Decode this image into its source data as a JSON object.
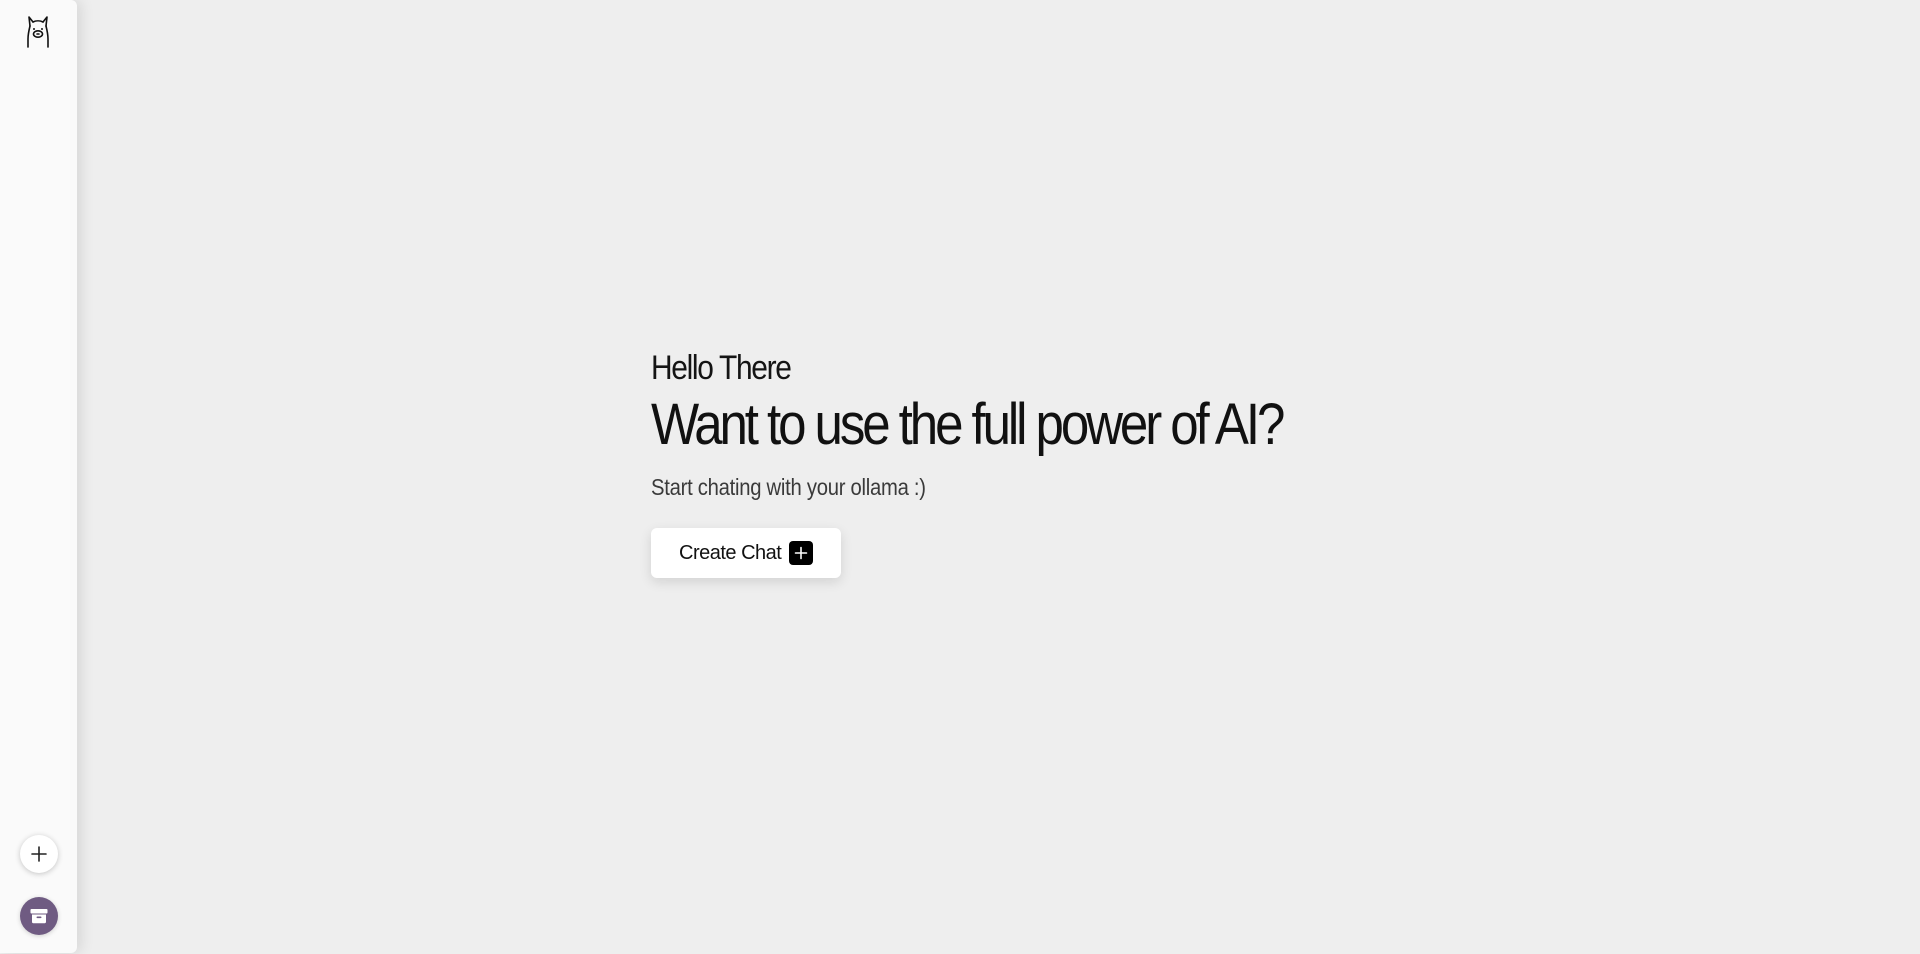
{
  "sidebar": {
    "logo_icon": "ollama-llama-icon",
    "new_chat_icon": "plus-icon",
    "archive_icon": "archive-box-icon"
  },
  "main": {
    "greeting": "Hello There",
    "headline": "Want to use the full power of AI?",
    "subtitle": "Start chating with your ollama :)",
    "create_chat_label": "Create Chat",
    "create_chat_icon": "plus-icon"
  },
  "colors": {
    "background": "#eeeeee",
    "sidebar": "#fafafa",
    "archive_button": "#6f5b82",
    "text": "#111111"
  }
}
